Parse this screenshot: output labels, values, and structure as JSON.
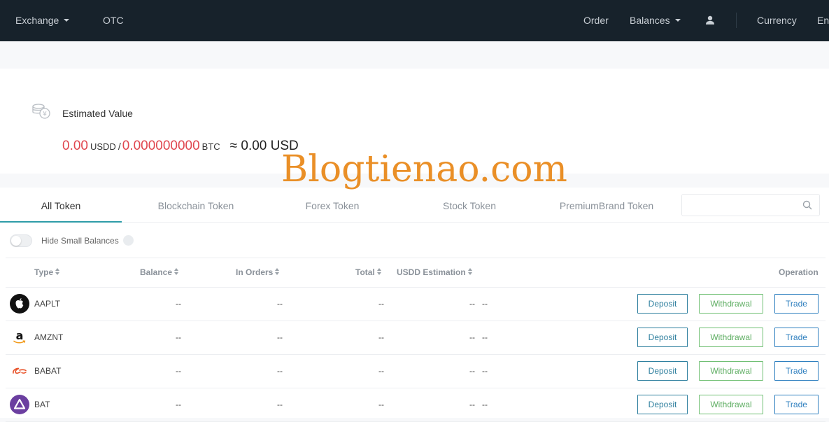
{
  "nav": {
    "exchange": "Exchange",
    "otc": "OTC",
    "order": "Order",
    "balances": "Balances",
    "currency": "Currency",
    "language": "En"
  },
  "estimate": {
    "label": "Estimated Value",
    "usdd_value": "0.00",
    "usdd_unit": "USDD",
    "separator": "/",
    "btc_value": "0.000000000",
    "btc_unit": "BTC",
    "usd_approx": "≈ 0.00 USD"
  },
  "tabs": [
    "All Token",
    "Blockchain Token",
    "Forex Token",
    "Stock Token",
    "PremiumBrand Token"
  ],
  "search": {
    "placeholder": ""
  },
  "filters": {
    "hide_small_label": "Hide Small Balances"
  },
  "table": {
    "headers": {
      "type": "Type",
      "balance": "Balance",
      "in_orders": "In Orders",
      "total": "Total",
      "usdd_estimation": "USDD Estimation",
      "operation": "Operation"
    },
    "rows": [
      {
        "token": "AAPLT",
        "balance": "--",
        "in_orders": "--",
        "total": "--",
        "usdd_est_a": "--",
        "usdd_est_b": "--"
      },
      {
        "token": "AMZNT",
        "balance": "--",
        "in_orders": "--",
        "total": "--",
        "usdd_est_a": "--",
        "usdd_est_b": "--"
      },
      {
        "token": "BABAT",
        "balance": "--",
        "in_orders": "--",
        "total": "--",
        "usdd_est_a": "--",
        "usdd_est_b": "--"
      },
      {
        "token": "BAT",
        "balance": "--",
        "in_orders": "--",
        "total": "--",
        "usdd_est_a": "--",
        "usdd_est_b": "--"
      }
    ],
    "actions": {
      "deposit": "Deposit",
      "withdrawal": "Withdrawal",
      "trade": "Trade"
    }
  },
  "watermark": "Blogtienao.com",
  "colors": {
    "topbar": "#17222b",
    "accent_red": "#e0474f",
    "tab_active": "#2e9ca8",
    "watermark": "#e98a1c"
  },
  "icons": [
    "coin-stack-icon",
    "user-icon",
    "search-icon",
    "apple-logo-icon",
    "amazon-logo-icon",
    "alibaba-logo-icon",
    "bat-logo-icon"
  ]
}
